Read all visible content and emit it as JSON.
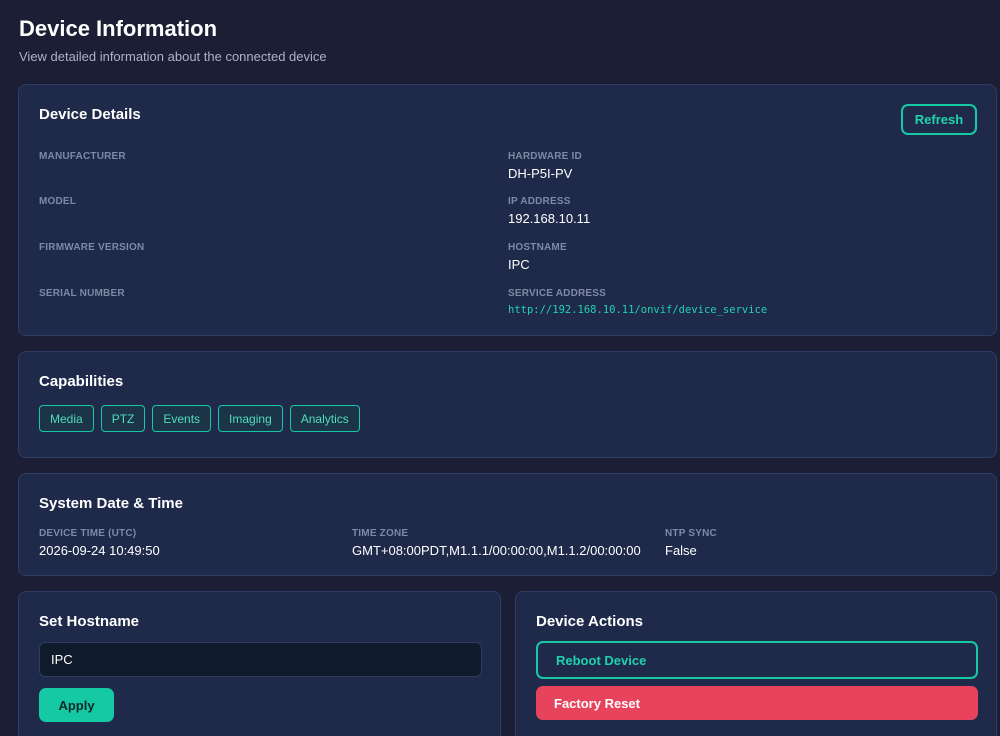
{
  "header": {
    "title": "Device Information",
    "subtitle": "View detailed information about the connected device"
  },
  "device_details": {
    "title": "Device Details",
    "refresh_label": "Refresh",
    "fields": {
      "manufacturer": {
        "label": "MANUFACTURER",
        "value": ""
      },
      "model": {
        "label": "MODEL",
        "value": ""
      },
      "firmware_version": {
        "label": "FIRMWARE VERSION",
        "value": ""
      },
      "serial_number": {
        "label": "SERIAL NUMBER",
        "value": ""
      },
      "hardware_id": {
        "label": "HARDWARE ID",
        "value": "DH-P5I-PV"
      },
      "ip_address": {
        "label": "IP ADDRESS",
        "value": "192.168.10.11"
      },
      "hostname": {
        "label": "HOSTNAME",
        "value": "IPC"
      },
      "service_address": {
        "label": "SERVICE ADDRESS",
        "value": "http://192.168.10.11/onvif/device_service"
      }
    }
  },
  "capabilities": {
    "title": "Capabilities",
    "items": [
      "Media",
      "PTZ",
      "Events",
      "Imaging",
      "Analytics"
    ]
  },
  "system_datetime": {
    "title": "System Date & Time",
    "device_time": {
      "label": "DEVICE TIME (UTC)",
      "value": "2026-09-24 10:49:50"
    },
    "time_zone": {
      "label": "TIME ZONE",
      "value": "GMT+08:00PDT,M1.1.1/00:00:00,M1.1.2/00:00:00"
    },
    "ntp_sync": {
      "label": "NTP SYNC",
      "value": "False"
    }
  },
  "set_hostname": {
    "title": "Set Hostname",
    "input_value": "IPC",
    "apply_label": "Apply"
  },
  "device_actions": {
    "title": "Device Actions",
    "reboot_label": "Reboot Device",
    "factory_reset_label": "Factory Reset"
  },
  "colors": {
    "background": "#1b1e35",
    "card": "#1f2a4a",
    "accent": "#14c9a3",
    "danger": "#e8435c"
  }
}
